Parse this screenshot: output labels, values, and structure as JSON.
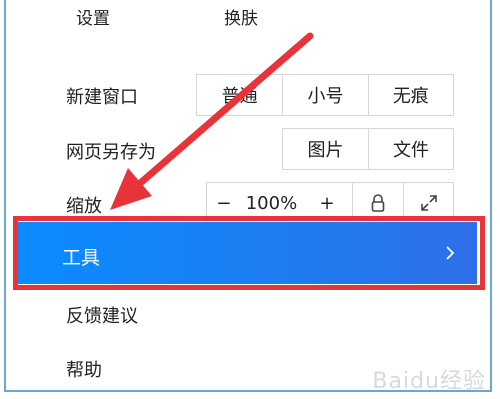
{
  "top_menu": {
    "settings_label": "设置",
    "skin_label": "换肤"
  },
  "menu": {
    "new_window": {
      "label": "新建窗口",
      "options": [
        "普通",
        "小号",
        "无痕"
      ]
    },
    "save_page_as": {
      "label": "网页另存为",
      "options": [
        "图片",
        "文件"
      ]
    },
    "zoom": {
      "label": "缩放",
      "minus": "−",
      "level": "100%",
      "plus": "+",
      "lock_icon": "lock-icon",
      "fullscreen_icon": "expand-icon"
    },
    "tools": {
      "label": "工具",
      "chevron": "chevron-right-icon"
    },
    "feedback": {
      "label": "反馈建议"
    },
    "help": {
      "label": "帮助"
    }
  },
  "watermark": "Baidu经验",
  "colors": {
    "highlight_blue": "#0a8cff",
    "annotation_red": "#e8333b",
    "frame_border": "#6aa6d6"
  }
}
